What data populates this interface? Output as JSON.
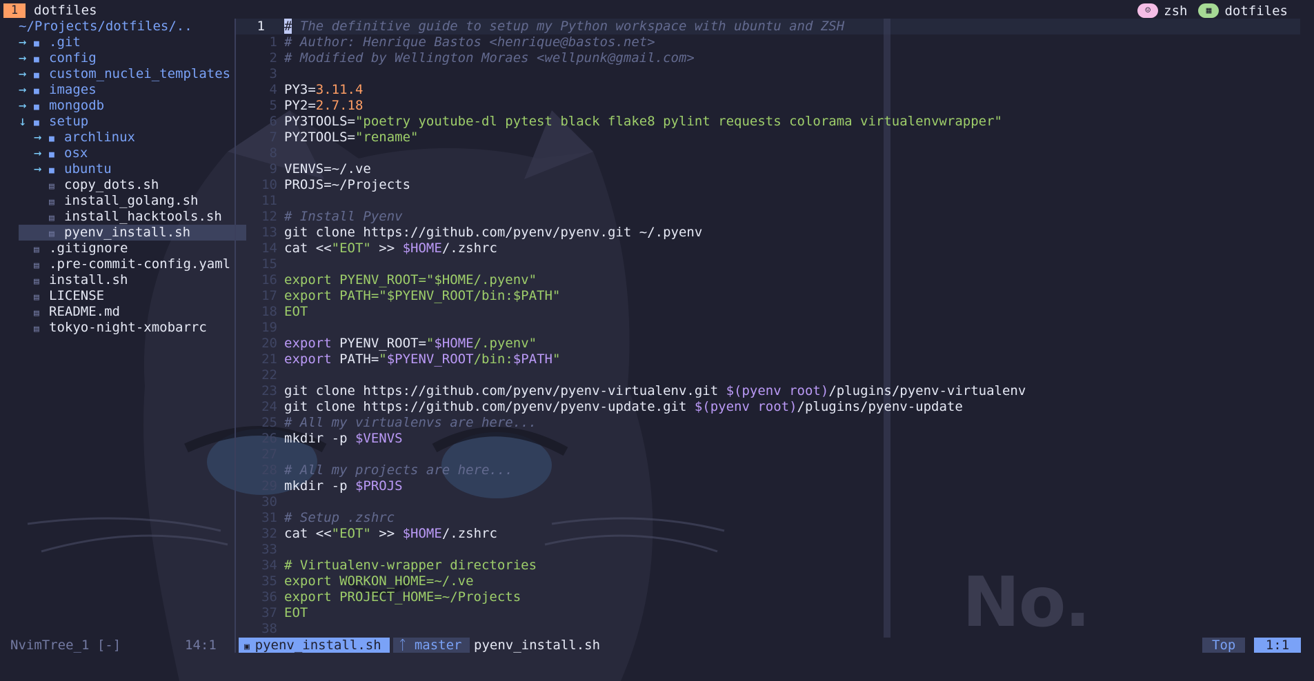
{
  "tabbar": {
    "tab_number": "1",
    "tab_title": "dotfiles",
    "right": [
      {
        "icon": "user-icon",
        "label": "zsh",
        "color": "#f5bde6"
      },
      {
        "icon": "terminal-icon",
        "label": "dotfiles",
        "color": "#a6da95"
      }
    ]
  },
  "tree": {
    "root": "~/Projects/dotfiles/..",
    "items": [
      {
        "label": ".git",
        "type": "dir",
        "depth": 0,
        "arrow": "→"
      },
      {
        "label": "config",
        "type": "dir",
        "depth": 0,
        "arrow": "→"
      },
      {
        "label": "custom_nuclei_templates",
        "type": "dir",
        "depth": 0,
        "arrow": "→"
      },
      {
        "label": "images",
        "type": "dir",
        "depth": 0,
        "arrow": "→"
      },
      {
        "label": "mongodb",
        "type": "dir",
        "depth": 0,
        "arrow": "→"
      },
      {
        "label": "setup",
        "type": "dir",
        "depth": 0,
        "arrow": "↓"
      },
      {
        "label": "archlinux",
        "type": "dir",
        "depth": 1,
        "arrow": "→"
      },
      {
        "label": "osx",
        "type": "dir",
        "depth": 1,
        "arrow": "→"
      },
      {
        "label": "ubuntu",
        "type": "dir",
        "depth": 1,
        "arrow": "→"
      },
      {
        "label": "copy_dots.sh",
        "type": "file",
        "depth": 1,
        "arrow": ""
      },
      {
        "label": "install_golang.sh",
        "type": "file",
        "depth": 1,
        "arrow": ""
      },
      {
        "label": "install_hacktools.sh",
        "type": "file",
        "depth": 1,
        "arrow": ""
      },
      {
        "label": "pyenv_install.sh",
        "type": "file",
        "depth": 1,
        "arrow": "",
        "selected": true
      },
      {
        "label": ".gitignore",
        "type": "file",
        "depth": 0,
        "arrow": ""
      },
      {
        "label": ".pre-commit-config.yaml",
        "type": "file",
        "depth": 0,
        "arrow": ""
      },
      {
        "label": "install.sh",
        "type": "file",
        "depth": 0,
        "arrow": ""
      },
      {
        "label": "LICENSE",
        "type": "file",
        "depth": 0,
        "arrow": ""
      },
      {
        "label": "README.md",
        "type": "file",
        "depth": 0,
        "arrow": ""
      },
      {
        "label": "tokyo-night-xmobarrc",
        "type": "file",
        "depth": 0,
        "arrow": ""
      }
    ]
  },
  "editor": {
    "lines": [
      {
        "n": "1",
        "cur": true,
        "segs": [
          [
            "cur",
            "#"
          ],
          [
            "cmt",
            " The definitive guide to setup my Python workspace with ubuntu and ZSH"
          ]
        ]
      },
      {
        "n": "1",
        "segs": [
          [
            "cmt",
            "# Author: Henrique Bastos <henrique@bastos.net>"
          ]
        ]
      },
      {
        "n": "2",
        "segs": [
          [
            "cmt",
            "# Modified by Wellington Moraes <wellpunk@gmail.com>"
          ]
        ]
      },
      {
        "n": "3",
        "segs": []
      },
      {
        "n": "4",
        "segs": [
          [
            "plain",
            "PY3="
          ],
          [
            "num",
            "3.11.4"
          ]
        ]
      },
      {
        "n": "5",
        "segs": [
          [
            "plain",
            "PY2="
          ],
          [
            "num",
            "2.7.18"
          ]
        ]
      },
      {
        "n": "6",
        "segs": [
          [
            "plain",
            "PY3TOOLS="
          ],
          [
            "str",
            "\"poetry youtube-dl pytest black flake8 pylint requests colorama virtualenvwrapper\""
          ]
        ]
      },
      {
        "n": "7",
        "segs": [
          [
            "plain",
            "PY2TOOLS="
          ],
          [
            "str",
            "\"rename\""
          ]
        ]
      },
      {
        "n": "8",
        "segs": []
      },
      {
        "n": "9",
        "segs": [
          [
            "plain",
            "VENVS=~/.ve"
          ]
        ]
      },
      {
        "n": "10",
        "segs": [
          [
            "plain",
            "PROJS=~/Projects"
          ]
        ]
      },
      {
        "n": "11",
        "segs": []
      },
      {
        "n": "12",
        "segs": [
          [
            "cmt",
            "# Install Pyenv"
          ]
        ]
      },
      {
        "n": "13",
        "segs": [
          [
            "plain",
            "git clone https://github.com/pyenv/pyenv.git ~/.pyenv"
          ]
        ]
      },
      {
        "n": "14",
        "segs": [
          [
            "plain",
            "cat <<"
          ],
          [
            "str",
            "\"EOT\""
          ],
          [
            "plain",
            " >> "
          ],
          [
            "var",
            "$HOME"
          ],
          [
            "plain",
            "/.zshrc"
          ]
        ]
      },
      {
        "n": "15",
        "segs": []
      },
      {
        "n": "16",
        "segs": [
          [
            "str",
            "export PYENV_ROOT=\"$HOME/.pyenv\""
          ]
        ]
      },
      {
        "n": "17",
        "segs": [
          [
            "str",
            "export PATH=\"$PYENV_ROOT/bin:$PATH\""
          ]
        ]
      },
      {
        "n": "18",
        "segs": [
          [
            "str",
            "EOT"
          ]
        ]
      },
      {
        "n": "19",
        "segs": []
      },
      {
        "n": "20",
        "segs": [
          [
            "kw",
            "export"
          ],
          [
            "plain",
            " PYENV_ROOT="
          ],
          [
            "str",
            "\""
          ],
          [
            "var",
            "$HOME"
          ],
          [
            "str",
            "/.pyenv\""
          ]
        ]
      },
      {
        "n": "21",
        "segs": [
          [
            "kw",
            "export"
          ],
          [
            "plain",
            " PATH="
          ],
          [
            "str",
            "\""
          ],
          [
            "var",
            "$PYENV_ROOT"
          ],
          [
            "str",
            "/bin:"
          ],
          [
            "var",
            "$PATH"
          ],
          [
            "str",
            "\""
          ]
        ]
      },
      {
        "n": "22",
        "segs": []
      },
      {
        "n": "23",
        "segs": [
          [
            "plain",
            "git clone https://github.com/pyenv/pyenv-virtualenv.git "
          ],
          [
            "var",
            "$(pyenv root)"
          ],
          [
            "plain",
            "/plugins/pyenv-virtualenv"
          ]
        ]
      },
      {
        "n": "24",
        "segs": [
          [
            "plain",
            "git clone https://github.com/pyenv/pyenv-update.git "
          ],
          [
            "var",
            "$(pyenv root)"
          ],
          [
            "plain",
            "/plugins/pyenv-update"
          ]
        ]
      },
      {
        "n": "25",
        "segs": [
          [
            "cmt",
            "# All my virtualenvs are here..."
          ]
        ]
      },
      {
        "n": "26",
        "segs": [
          [
            "plain",
            "mkdir -p "
          ],
          [
            "var",
            "$VENVS"
          ]
        ]
      },
      {
        "n": "27",
        "segs": []
      },
      {
        "n": "28",
        "segs": [
          [
            "cmt",
            "# All my projects are here..."
          ]
        ]
      },
      {
        "n": "29",
        "segs": [
          [
            "plain",
            "mkdir -p "
          ],
          [
            "var",
            "$PROJS"
          ]
        ]
      },
      {
        "n": "30",
        "segs": []
      },
      {
        "n": "31",
        "segs": [
          [
            "cmt",
            "# Setup .zshrc"
          ]
        ]
      },
      {
        "n": "32",
        "segs": [
          [
            "plain",
            "cat <<"
          ],
          [
            "str",
            "\"EOT\""
          ],
          [
            "plain",
            " >> "
          ],
          [
            "var",
            "$HOME"
          ],
          [
            "plain",
            "/.zshrc"
          ]
        ]
      },
      {
        "n": "33",
        "segs": []
      },
      {
        "n": "34",
        "segs": [
          [
            "str",
            "# Virtualenv-wrapper directories"
          ]
        ]
      },
      {
        "n": "35",
        "segs": [
          [
            "str",
            "export WORKON_HOME=~/.ve"
          ]
        ]
      },
      {
        "n": "36",
        "segs": [
          [
            "str",
            "export PROJECT_HOME=~/Projects"
          ]
        ]
      },
      {
        "n": "37",
        "segs": [
          [
            "str",
            "EOT"
          ]
        ]
      },
      {
        "n": "38",
        "segs": []
      }
    ]
  },
  "statusbar": {
    "tree_name": "NvimTree_1 [-]",
    "tree_pos": "14:1",
    "file_tab": "pyenv_install.sh",
    "branch": "master",
    "file_name": "pyenv_install.sh",
    "scroll": "Top",
    "cursor": "1:1"
  },
  "wallpaper_text": "No.",
  "colors": {
    "background": "#1f2030",
    "accent": "#7aa2f7",
    "string": "#9ece6a",
    "number": "#ff9e64",
    "keyword": "#bb9af7",
    "comment": "#636a8f"
  }
}
